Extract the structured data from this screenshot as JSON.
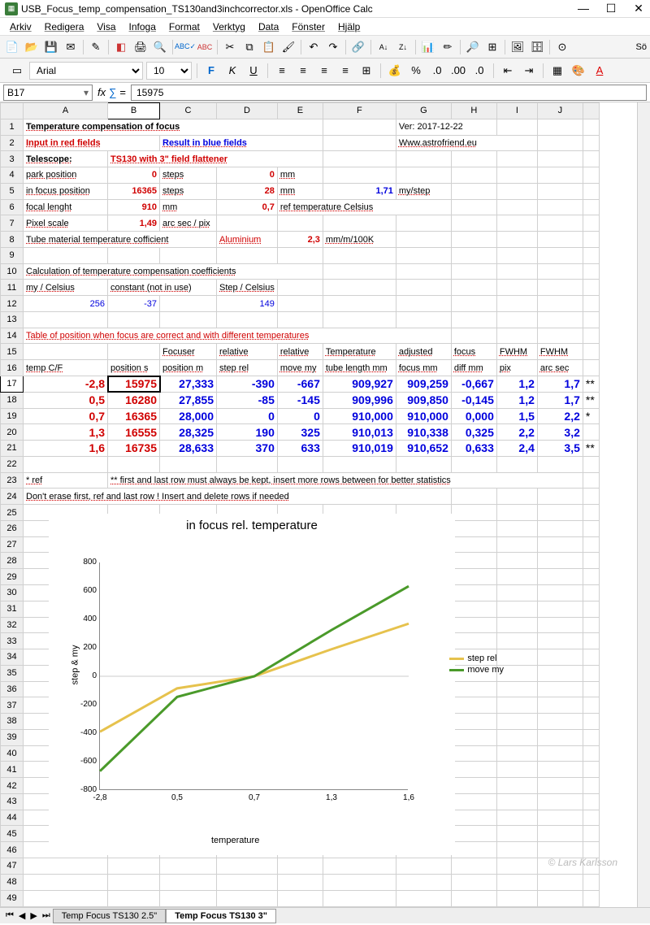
{
  "window": {
    "title": "USB_Focus_temp_compensation_TS130and3inchcorrector.xls - OpenOffice Calc"
  },
  "menu": [
    "Arkiv",
    "Redigera",
    "Visa",
    "Infoga",
    "Format",
    "Verktyg",
    "Data",
    "Fönster",
    "Hjälp"
  ],
  "format_bar": {
    "font": "Arial",
    "size": "10"
  },
  "cell_ref": {
    "name": "B17",
    "fx": "fx",
    "sigma": "∑",
    "eq": "=",
    "value": "15975"
  },
  "columns": [
    "A",
    "B",
    "C",
    "D",
    "E",
    "F",
    "G",
    "H",
    "I",
    "J"
  ],
  "rows_count": 49,
  "selected": {
    "col": "B",
    "row": 17
  },
  "cells": {
    "r1": {
      "A": "Temperature compensation of focus",
      "G": "Ver: 2017-12-22"
    },
    "r2": {
      "A": "Input in red fields",
      "C": "Result in blue fields",
      "G": "Www.astrofriend.eu"
    },
    "r3": {
      "A": "Telescope:",
      "B_span": "TS130 with 3\" field flattener"
    },
    "r4": {
      "A": "park position",
      "B": "0",
      "C": "steps",
      "D": "0",
      "E": "mm"
    },
    "r5": {
      "A": "in focus position",
      "B": "16365",
      "C": "steps",
      "D": "28",
      "E": "mm",
      "F": "1,71",
      "G": "my/step"
    },
    "r6": {
      "A": "focal lenght",
      "B": "910",
      "C": "mm",
      "D": "0,7",
      "E_span": "ref temperature Celsius"
    },
    "r7": {
      "A": "Pixel scale",
      "B": "1,49",
      "C": "arc sec / pix"
    },
    "r8": {
      "A_span": "Tube material temperature cofficient",
      "D": "Aluminium",
      "E": "2,3",
      "F": "mm/m/100K"
    },
    "r10": {
      "A_span": "Calculation of temperature compensation coefficients"
    },
    "r11": {
      "A": "my / Celsius",
      "B_span": "constant (not in use)",
      "D": "Step / Celsius"
    },
    "r12": {
      "A": "256",
      "B": "-37",
      "D": "149"
    },
    "r14": {
      "A_span": "Table of position when focus are correct and with different temperatures"
    },
    "r15": {
      "C": "Focuser",
      "D": "relative",
      "E": "relative",
      "F": "Temperature",
      "G": "adjusted",
      "H": "focus",
      "I": "FWHM",
      "J": "FWHM"
    },
    "r16": {
      "A": "temp C/F",
      "B": "position s",
      "C": "position m",
      "D": "step rel",
      "E": "move my",
      "F": "tube length mm",
      "G": "focus mm",
      "H": "diff mm",
      "I": "pix",
      "J": "arc sec"
    },
    "r17": {
      "A": "-2,8",
      "B": "15975",
      "C": "27,333",
      "D": "-390",
      "E": "-667",
      "F": "909,927",
      "G": "909,259",
      "H": "-0,667",
      "I": "1,2",
      "J": "1,7",
      "K": "**"
    },
    "r18": {
      "A": "0,5",
      "B": "16280",
      "C": "27,855",
      "D": "-85",
      "E": "-145",
      "F": "909,996",
      "G": "909,850",
      "H": "-0,145",
      "I": "1,2",
      "J": "1,7",
      "K": "**"
    },
    "r19": {
      "A": "0,7",
      "B": "16365",
      "C": "28,000",
      "D": "0",
      "E": "0",
      "F": "910,000",
      "G": "910,000",
      "H": "0,000",
      "I": "1,5",
      "J": "2,2",
      "K": "*"
    },
    "r20": {
      "A": "1,3",
      "B": "16555",
      "C": "28,325",
      "D": "190",
      "E": "325",
      "F": "910,013",
      "G": "910,338",
      "H": "0,325",
      "I": "2,2",
      "J": "3,2"
    },
    "r21": {
      "A": "1,6",
      "B": "16735",
      "C": "28,633",
      "D": "370",
      "E": "633",
      "F": "910,019",
      "G": "910,652",
      "H": "0,633",
      "I": "2,4",
      "J": "3,5",
      "K": "**"
    },
    "r23": {
      "A": "* ref",
      "B_span": "** first and last row must always be kept, insert more rows between for better statistics"
    },
    "r24": {
      "A_span": "Don't erase first, ref and last row ! Insert and delete rows if needed"
    }
  },
  "chart_data": {
    "type": "line",
    "title": "in focus rel. temperature",
    "xlabel": "temperature",
    "ylabel": "step & my",
    "x": [
      -2.8,
      0.5,
      0.7,
      1.3,
      1.6
    ],
    "series": [
      {
        "name": "step rel",
        "color": "#e6c24d",
        "values": [
          -390,
          -85,
          0,
          190,
          370
        ]
      },
      {
        "name": "move my",
        "color": "#4a9a2a",
        "values": [
          -667,
          -145,
          0,
          325,
          633
        ]
      }
    ],
    "ylim": [
      -800,
      800
    ],
    "yticks": [
      -800,
      -600,
      -400,
      -200,
      0,
      200,
      400,
      600,
      800
    ],
    "xticks": [
      "-2,8",
      "0,5",
      "0,7",
      "1,3",
      "1,6"
    ]
  },
  "watermark": "© Lars Karlsson",
  "tabs": {
    "inactive": "Temp Focus TS130 2.5\"",
    "active": "Temp Focus TS130 3\""
  },
  "search_hint": "Sö"
}
